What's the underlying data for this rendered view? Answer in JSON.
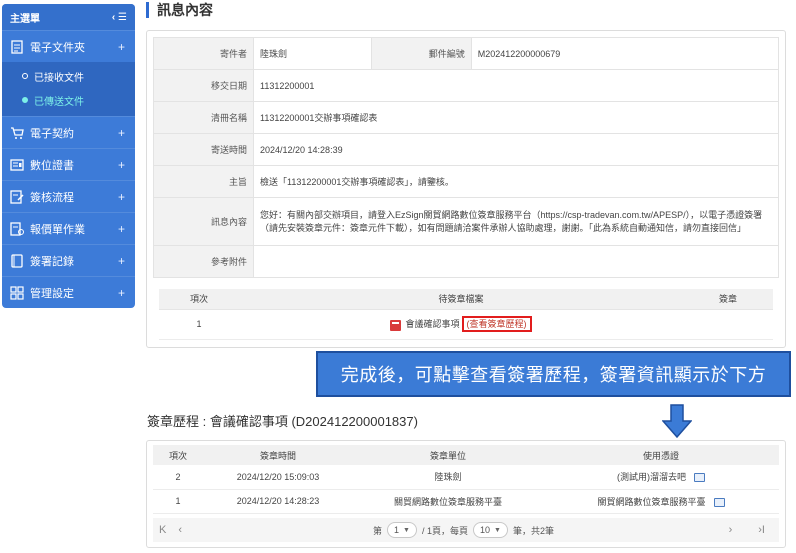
{
  "sidebar": {
    "title": "主選單",
    "toggle": "‹ ☰",
    "items": [
      {
        "label": "電子文件夾",
        "icon": "document-list-icon"
      },
      {
        "label": "電子契約",
        "icon": "cart-icon"
      },
      {
        "label": "數位證書",
        "icon": "certificate-icon"
      },
      {
        "label": "簽核流程",
        "icon": "approval-flow-icon"
      },
      {
        "label": "報價單作業",
        "icon": "quote-form-icon"
      },
      {
        "label": "簽署記錄",
        "icon": "record-book-icon"
      },
      {
        "label": "管理設定",
        "icon": "settings-grid-icon"
      }
    ],
    "sub_items": [
      {
        "label": "已接收文件",
        "active": false
      },
      {
        "label": "已傳送文件",
        "active": true
      }
    ],
    "expand_symbol": "+"
  },
  "page_title": "訊息內容",
  "message": {
    "sender_label": "寄件者",
    "sender": "陸珠劍",
    "mail_no_label": "郵件編號",
    "mail_no": "M202412200000679",
    "handover_label": "移交日期",
    "handover": "11312200001",
    "list_name_label": "清冊名稱",
    "list_name": "11312200001交辦事項確認表",
    "sent_time_label": "寄送時間",
    "sent_time": "2024/12/20 14:28:39",
    "subject_label": "主旨",
    "subject": "檢送「11312200001交辦事項確認表」，請鑒核。",
    "content_label": "訊息內容",
    "content": "您好：有關內部交辦項目，請登入EzSign關貿網路數位簽章服務平台（https://csp-tradevan.com.tw/APESP/），以電子憑證簽署（請先安裝簽章元件：簽章元件下載），如有問題請洽案件承辦人協助處理，謝謝。「此為系統自動通知信，請勿直接回信」",
    "attachment_label": "參考附件"
  },
  "pending": {
    "headers": [
      "項次",
      "待簽章檔案",
      "簽章"
    ],
    "row": {
      "index": "1",
      "file": "會議確認事項",
      "history_link": "(查看簽章歷程)"
    }
  },
  "callout": "完成後，可點擊查看簽署歷程，簽署資訊顯示於下方",
  "history": {
    "title": "簽章歷程 : 會議確認事項 (D202412200001837)",
    "headers": [
      "項次",
      "簽章時間",
      "簽章單位",
      "使用憑證"
    ],
    "rows": [
      {
        "index": "2",
        "time": "2024/12/20 15:09:03",
        "unit": "陸珠劍",
        "cert": "(測試用)溜溜去吧"
      },
      {
        "index": "1",
        "time": "2024/12/20 14:28:23",
        "unit": "關貿網路數位簽章服務平臺",
        "cert": "關貿網路數位簽章服務平臺"
      }
    ],
    "pager": {
      "first": "K",
      "prev": "‹",
      "page_prefix": "第",
      "page": "1",
      "page_suffix": "/ 1頁，每頁",
      "per_page": "10",
      "total": "筆，共2筆",
      "next": "›",
      "last": "›I"
    }
  },
  "colors": {
    "sidebar": "#3d7bd8",
    "accent": "#2e6bd1",
    "callout": "#3b7bd6",
    "highlight_border": "#e21d1d",
    "active_sub": "#7cf0e8"
  }
}
